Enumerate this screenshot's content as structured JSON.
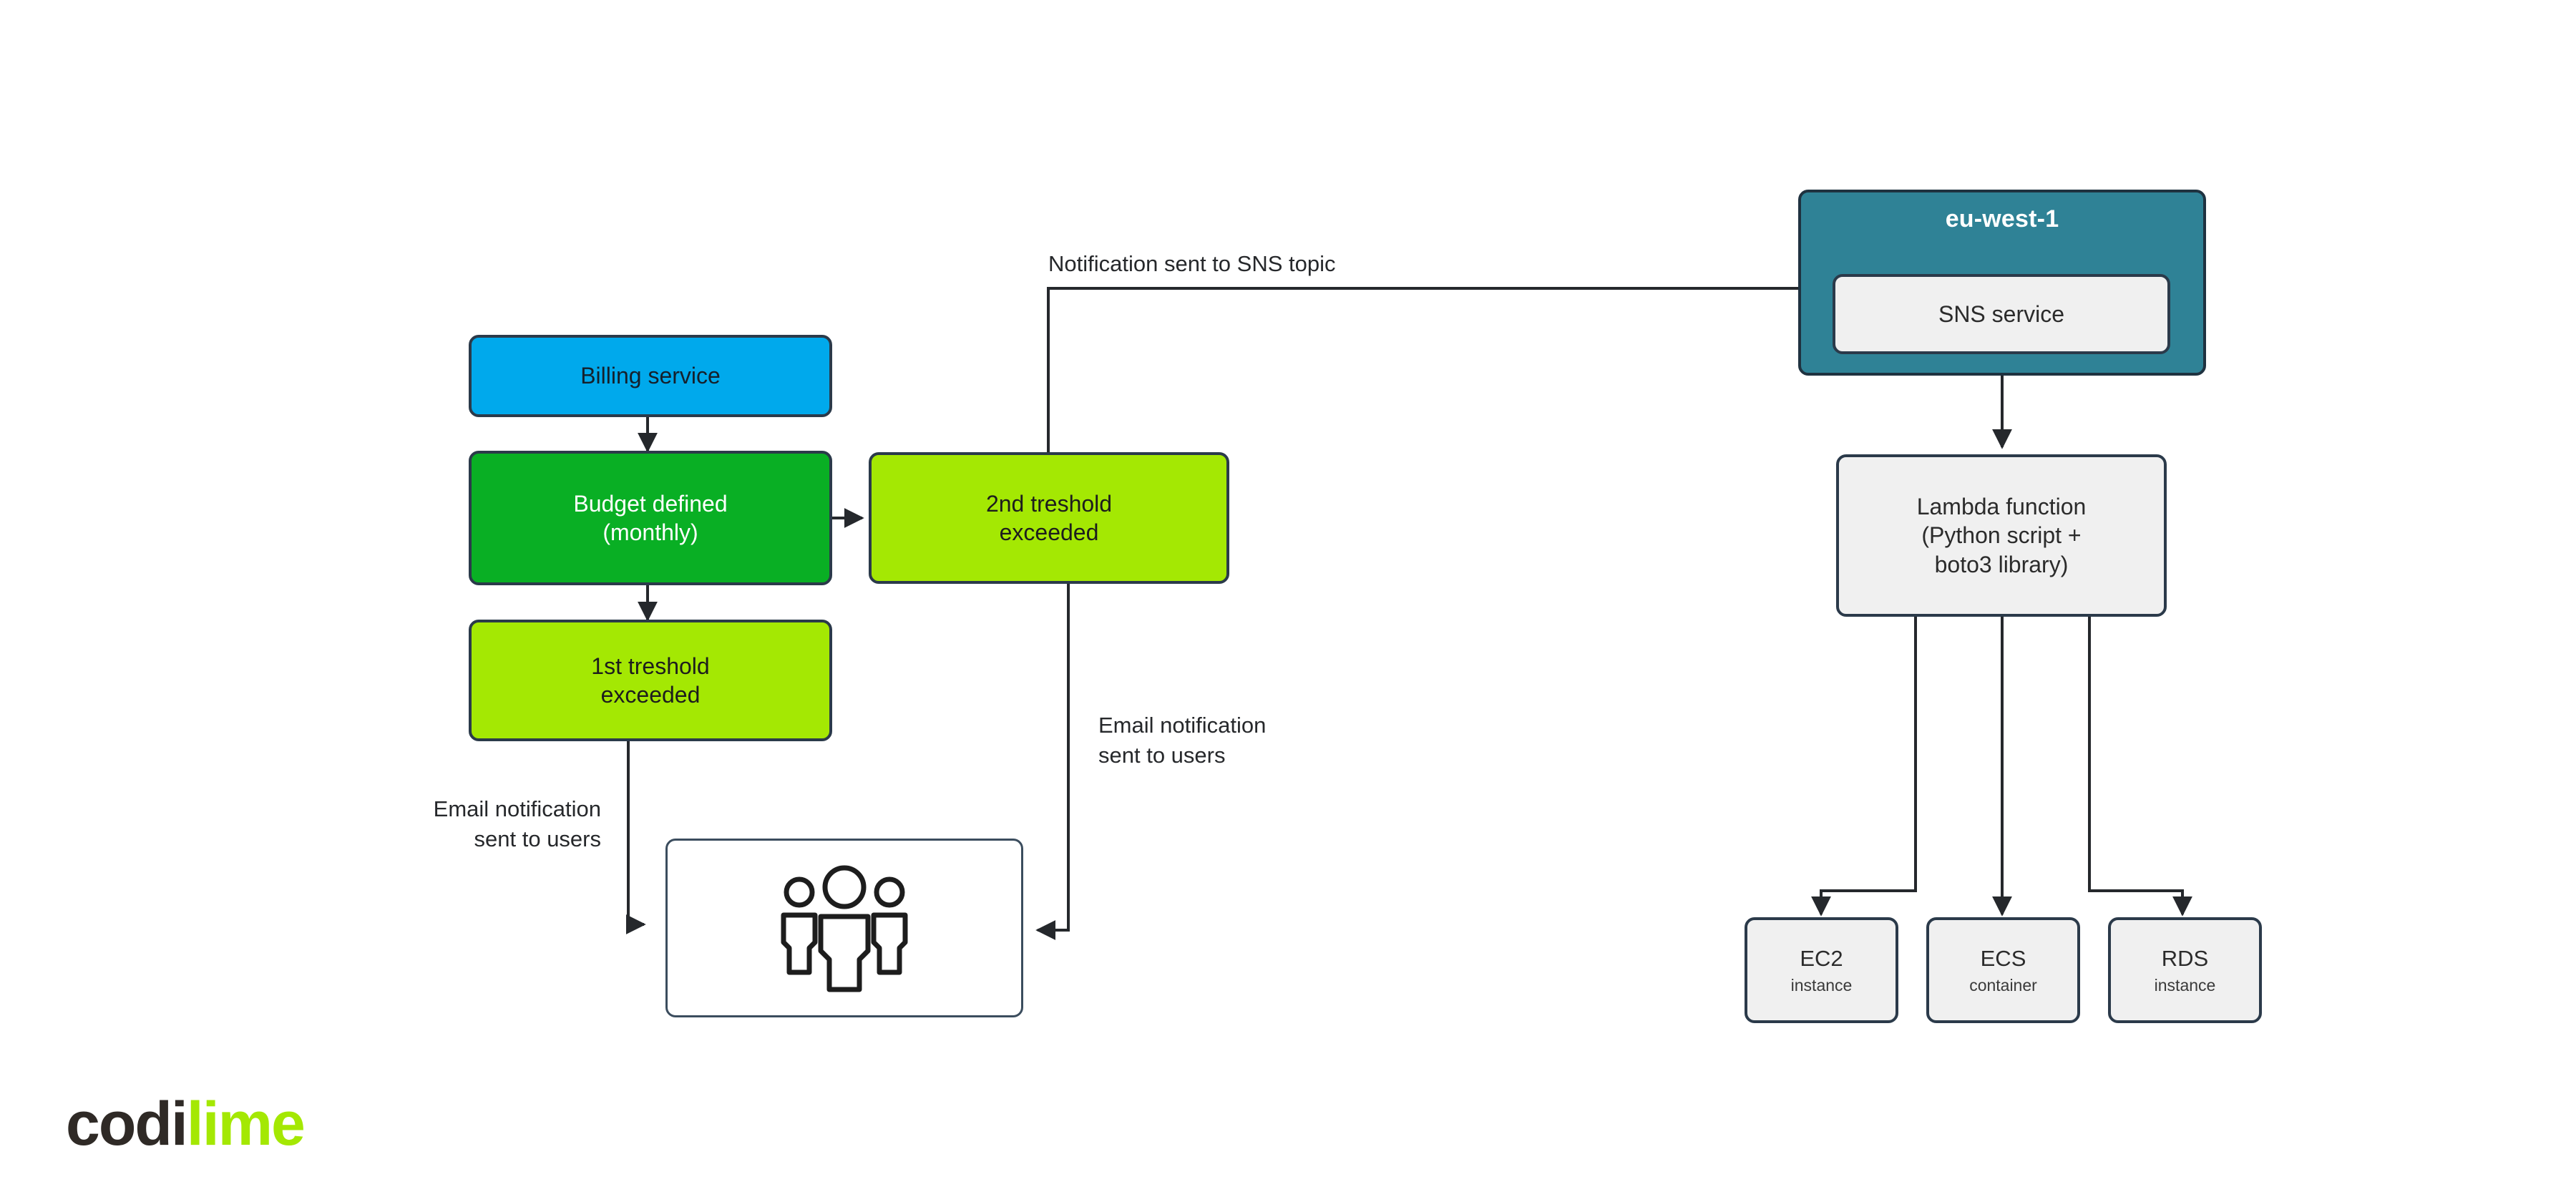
{
  "diagram": {
    "title": "AWS budget threshold notification and resource shutdown flow",
    "colors": {
      "blue": "#00A9EC",
      "green": "#09AF24",
      "lime": "#A4E803",
      "teal_region": "#2F8296",
      "grey_box": "#F0F0F0",
      "border": "#2B3A4A",
      "logo_dark": "#2F2A26",
      "logo_lime": "#A4E803"
    },
    "nodes": {
      "billing_service": "Billing service",
      "budget_defined": "Budget defined\n(monthly)",
      "first_threshold": "1st treshold\nexceeded",
      "second_threshold": "2nd treshold\nexceeded",
      "sns_service": "SNS service",
      "lambda_function": "Lambda function\n(Python script +\nboto3 library)"
    },
    "region": {
      "name": "eu-west-1"
    },
    "resources": [
      {
        "title": "EC2",
        "subtitle": "instance"
      },
      {
        "title": "ECS",
        "subtitle": "container"
      },
      {
        "title": "RDS",
        "subtitle": "instance"
      }
    ],
    "edge_labels": {
      "sns_topic": "Notification sent to SNS topic",
      "email_left": "Email notification\nsent to users",
      "email_mid": "Email notification\nsent to users"
    },
    "users": {
      "icon": "users-group-icon"
    },
    "logo": {
      "part_one": "codi",
      "part_two": "lime"
    }
  }
}
